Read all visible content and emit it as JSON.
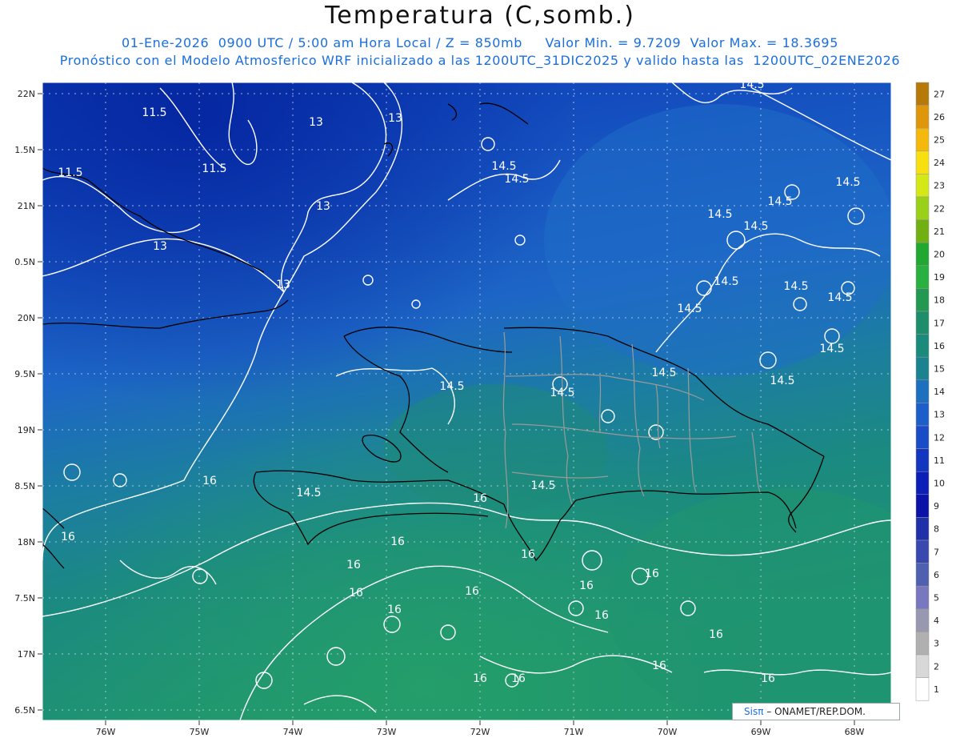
{
  "header": {
    "title": "Temperatura (C,somb.)",
    "subtitle_1": "01-Ene-2026  0900 UTC / 5:00 am Hora Local / Z = 850mb     Valor Min. = 9.7209  Valor Max. = 18.3695",
    "subtitle_2": "Pronóstico con el Modelo Atmosferico WRF inicializado a las 1200UTC_31DIC2025 y valido hasta las  1200UTC_02ENE2026"
  },
  "map": {
    "lat_labels": [
      "22N",
      "1.5N",
      "21N",
      "0.5N",
      "20N",
      "9.5N",
      "19N",
      "8.5N",
      "18N",
      "7.5N",
      "17N",
      "6.5N"
    ],
    "lon_labels": [
      "76W",
      "75W",
      "74W",
      "73W",
      "72W",
      "71W",
      "70W",
      "69W",
      "68W"
    ],
    "contour_labels": [
      {
        "text": "11.5"
      },
      {
        "text": "11.5"
      },
      {
        "text": "11.5"
      },
      {
        "text": "13"
      },
      {
        "text": "13"
      },
      {
        "text": "13"
      },
      {
        "text": "13"
      },
      {
        "text": "13"
      },
      {
        "text": "14.5"
      },
      {
        "text": "14.5"
      },
      {
        "text": "14.5"
      },
      {
        "text": "14.5"
      },
      {
        "text": "14.5"
      },
      {
        "text": "14.5"
      },
      {
        "text": "14.5"
      },
      {
        "text": "14.5"
      },
      {
        "text": "14.5"
      },
      {
        "text": "14.5"
      },
      {
        "text": "14.5"
      },
      {
        "text": "14.5"
      },
      {
        "text": "14.5"
      },
      {
        "text": "14.5"
      },
      {
        "text": "14.5"
      },
      {
        "text": "14.5"
      },
      {
        "text": "14.5"
      },
      {
        "text": "14.5"
      },
      {
        "text": "16"
      },
      {
        "text": "16"
      },
      {
        "text": "16"
      },
      {
        "text": "16"
      },
      {
        "text": "16"
      },
      {
        "text": "16"
      },
      {
        "text": "16"
      },
      {
        "text": "16"
      },
      {
        "text": "16"
      },
      {
        "text": "16"
      },
      {
        "text": "16"
      },
      {
        "text": "16"
      },
      {
        "text": "16"
      },
      {
        "text": "16"
      },
      {
        "text": "16"
      },
      {
        "text": "16"
      },
      {
        "text": "16"
      }
    ],
    "colors": {
      "cold": "#0b3fb8",
      "mid": "#1d5fc8",
      "warm": "#1a8a7a",
      "land_warm": "#22946a",
      "coast": "#000000",
      "border": "#9a9a9a"
    }
  },
  "colorbar": {
    "levels": [
      "27",
      "26",
      "25",
      "24",
      "23",
      "22",
      "21",
      "20",
      "19",
      "18",
      "17",
      "16",
      "15",
      "14",
      "13",
      "12",
      "11",
      "10",
      "9",
      "8",
      "7",
      "6",
      "5",
      "4",
      "3",
      "2",
      "1"
    ],
    "colors": [
      "#b77a08",
      "#e0960a",
      "#f5b80c",
      "#f8e010",
      "#d4e818",
      "#9ad018",
      "#72b012",
      "#20a830",
      "#28b040",
      "#229850",
      "#1e8e6a",
      "#1a8a7a",
      "#1b8290",
      "#1d6fc0",
      "#1d5fc8",
      "#1a4cc8",
      "#1236c0",
      "#0b1eb8",
      "#0a12a8",
      "#2030a8",
      "#3848b0",
      "#5060b0",
      "#7878c0",
      "#9898b0",
      "#b0b0b0",
      "#d8d8d8",
      "#ffffff"
    ]
  },
  "credit": {
    "brand": "Sisπ",
    "text": "– ONAMET/REP.DOM."
  }
}
